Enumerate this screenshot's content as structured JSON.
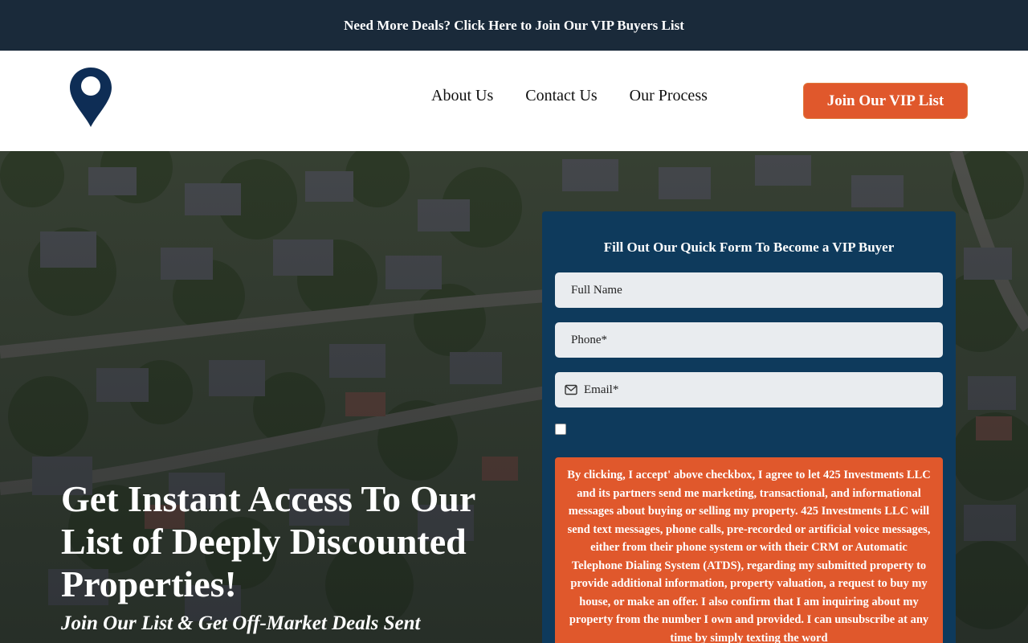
{
  "topbar": {
    "link_text": "Need More Deals? Click Here to Join Our VIP Buyers List"
  },
  "nav": {
    "items": [
      {
        "label": "About Us"
      },
      {
        "label": "Contact Us"
      },
      {
        "label": "Our Process"
      }
    ],
    "cta_label": "Join Our VIP List"
  },
  "colors": {
    "dark_navy": "#1a2a3a",
    "form_blue": "#0e3a5c",
    "accent_orange": "#e0582c",
    "logo_navy": "#0e2d55"
  },
  "hero": {
    "headline": "Get Instant Access To Our List of Deeply Discounted Properties!",
    "subheadline": "Join Our List & Get Off-Market Deals Sent"
  },
  "form": {
    "title": "Fill Out Our Quick Form To Become a VIP Buyer",
    "full_name_placeholder": "Full Name",
    "phone_placeholder": "Phone*",
    "email_placeholder": "Email*",
    "email_icon": "envelope-icon",
    "consent_text": "By clicking, I accept' above checkbox, I agree to let 425 Investments LLC and its partners send me marketing, transactional, and informational messages about buying or selling my property. 425 Investments LLC will send text messages, phone calls, pre-recorded or artificial voice messages, either from their phone system or with their CRM or Automatic Telephone Dialing System (ATDS), regarding my submitted property to provide additional information, property valuation, a request to buy my house, or make an offer. I also confirm that I am inquiring about my property from the number I own and provided. I can unsubscribe at any time by simply texting the word"
  },
  "logo": {
    "icon": "map-pin-icon"
  }
}
